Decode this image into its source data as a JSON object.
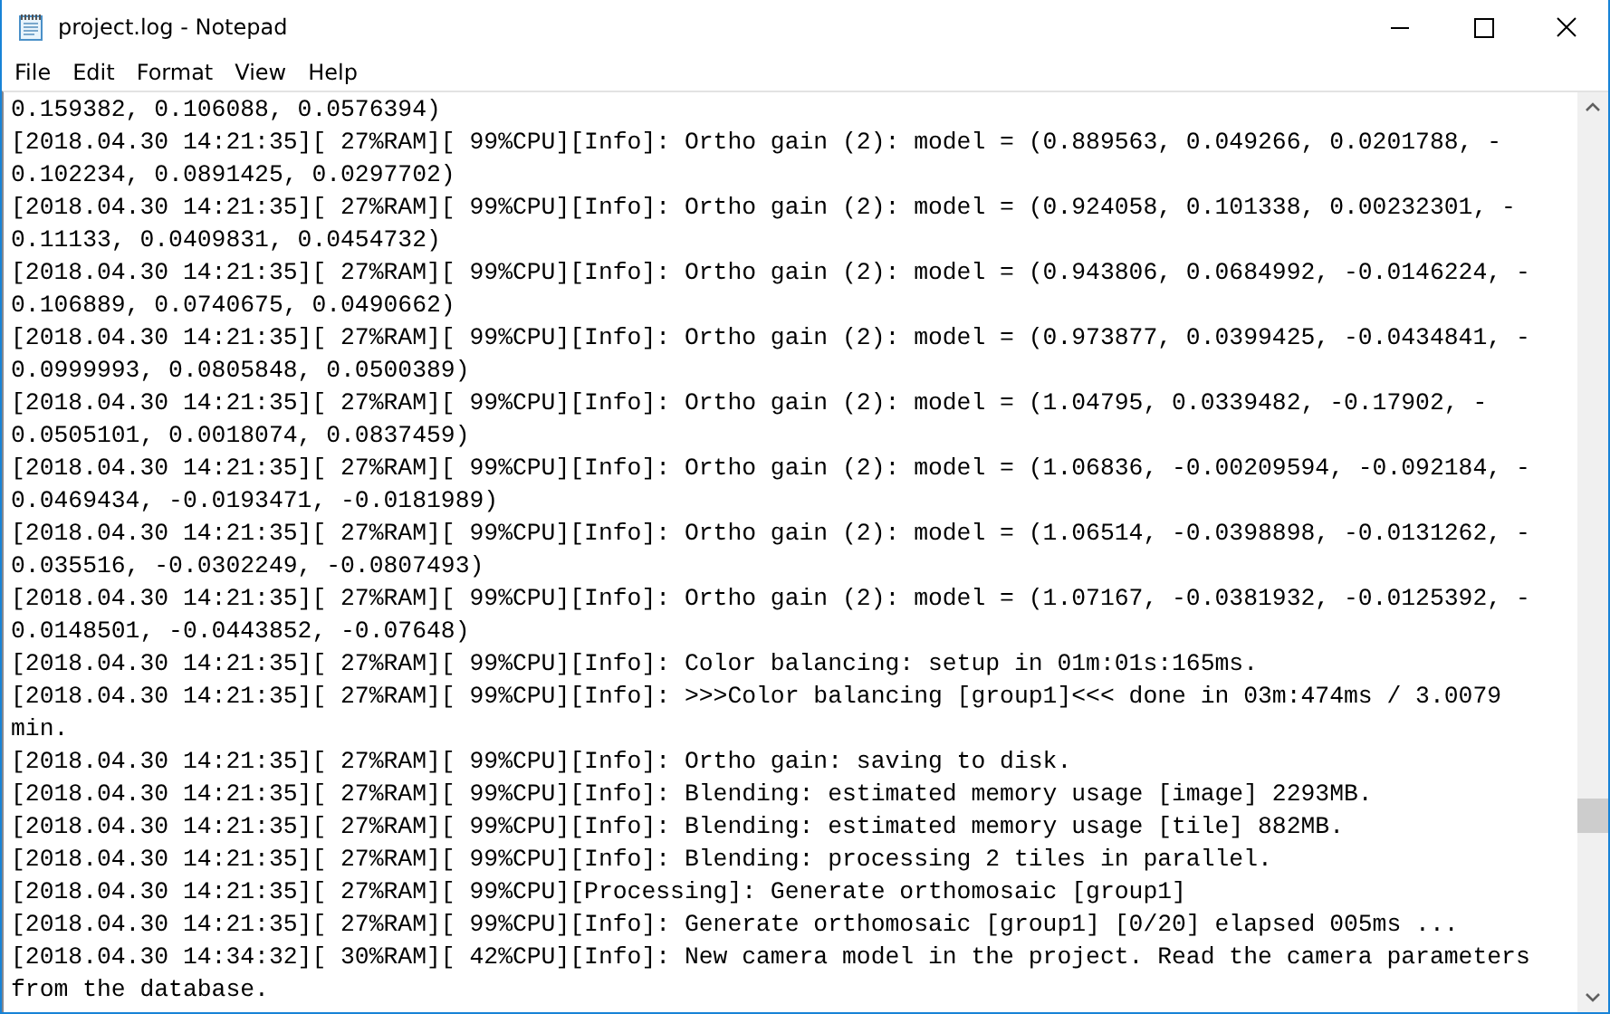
{
  "window": {
    "title": "project.log - Notepad"
  },
  "menu": [
    "File",
    "Edit",
    "Format",
    "View",
    "Help"
  ],
  "lines": [
    "0.159382, 0.106088, 0.0576394)",
    "[2018.04.30 14:21:35][ 27%RAM][ 99%CPU][Info]: Ortho gain (2): model = (0.889563, 0.049266, 0.0201788, -",
    "0.102234, 0.0891425, 0.0297702)",
    "[2018.04.30 14:21:35][ 27%RAM][ 99%CPU][Info]: Ortho gain (2): model = (0.924058, 0.101338, 0.00232301, -",
    "0.11133, 0.0409831, 0.0454732)",
    "[2018.04.30 14:21:35][ 27%RAM][ 99%CPU][Info]: Ortho gain (2): model = (0.943806, 0.0684992, -0.0146224, -",
    "0.106889, 0.0740675, 0.0490662)",
    "[2018.04.30 14:21:35][ 27%RAM][ 99%CPU][Info]: Ortho gain (2): model = (0.973877, 0.0399425, -0.0434841, -",
    "0.0999993, 0.0805848, 0.0500389)",
    "[2018.04.30 14:21:35][ 27%RAM][ 99%CPU][Info]: Ortho gain (2): model = (1.04795, 0.0339482, -0.17902, -",
    "0.0505101, 0.0018074, 0.0837459)",
    "[2018.04.30 14:21:35][ 27%RAM][ 99%CPU][Info]: Ortho gain (2): model = (1.06836, -0.00209594, -0.092184, -",
    "0.0469434, -0.0193471, -0.0181989)",
    "[2018.04.30 14:21:35][ 27%RAM][ 99%CPU][Info]: Ortho gain (2): model = (1.06514, -0.0398898, -0.0131262, -",
    "0.035516, -0.0302249, -0.0807493)",
    "[2018.04.30 14:21:35][ 27%RAM][ 99%CPU][Info]: Ortho gain (2): model = (1.07167, -0.0381932, -0.0125392, -",
    "0.0148501, -0.0443852, -0.07648)",
    "[2018.04.30 14:21:35][ 27%RAM][ 99%CPU][Info]: Color balancing: setup in 01m:01s:165ms.",
    "[2018.04.30 14:21:35][ 27%RAM][ 99%CPU][Info]: >>>Color balancing [group1]<<< done in 03m:474ms / 3.0079",
    "min.",
    "[2018.04.30 14:21:35][ 27%RAM][ 99%CPU][Info]: Ortho gain: saving to disk.",
    "[2018.04.30 14:21:35][ 27%RAM][ 99%CPU][Info]: Blending: estimated memory usage [image] 2293MB.",
    "[2018.04.30 14:21:35][ 27%RAM][ 99%CPU][Info]: Blending: estimated memory usage [tile] 882MB.",
    "[2018.04.30 14:21:35][ 27%RAM][ 99%CPU][Info]: Blending: processing 2 tiles in parallel.",
    "[2018.04.30 14:21:35][ 27%RAM][ 99%CPU][Processing]: Generate orthomosaic [group1]",
    "[2018.04.30 14:21:35][ 27%RAM][ 99%CPU][Info]: Generate orthomosaic [group1] [0/20] elapsed 005ms ...",
    "[2018.04.30 14:34:32][ 30%RAM][ 42%CPU][Info]: New camera model in the project. Read the camera parameters",
    "from the database."
  ]
}
